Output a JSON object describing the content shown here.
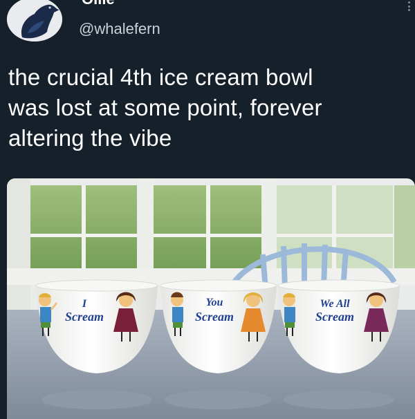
{
  "tweet": {
    "display_name": "Ollie",
    "handle": "@whalefern",
    "text_lines": [
      "the crucial 4th ice cream bowl",
      "was lost at some point, forever",
      "altering the vibe"
    ]
  },
  "photo": {
    "bowls": [
      {
        "lines": [
          "I",
          "Scream"
        ]
      },
      {
        "lines": [
          "You",
          "Scream"
        ]
      },
      {
        "lines": [
          "We All",
          "Scream"
        ]
      }
    ]
  },
  "colors": {
    "background": "#15202b",
    "text": "#ffffff",
    "handle": "#c9d1d9",
    "bowl_text": "#1f3f8f"
  },
  "icons": {
    "avatar": "crow-avatar-icon",
    "more": "more-options-icon"
  }
}
